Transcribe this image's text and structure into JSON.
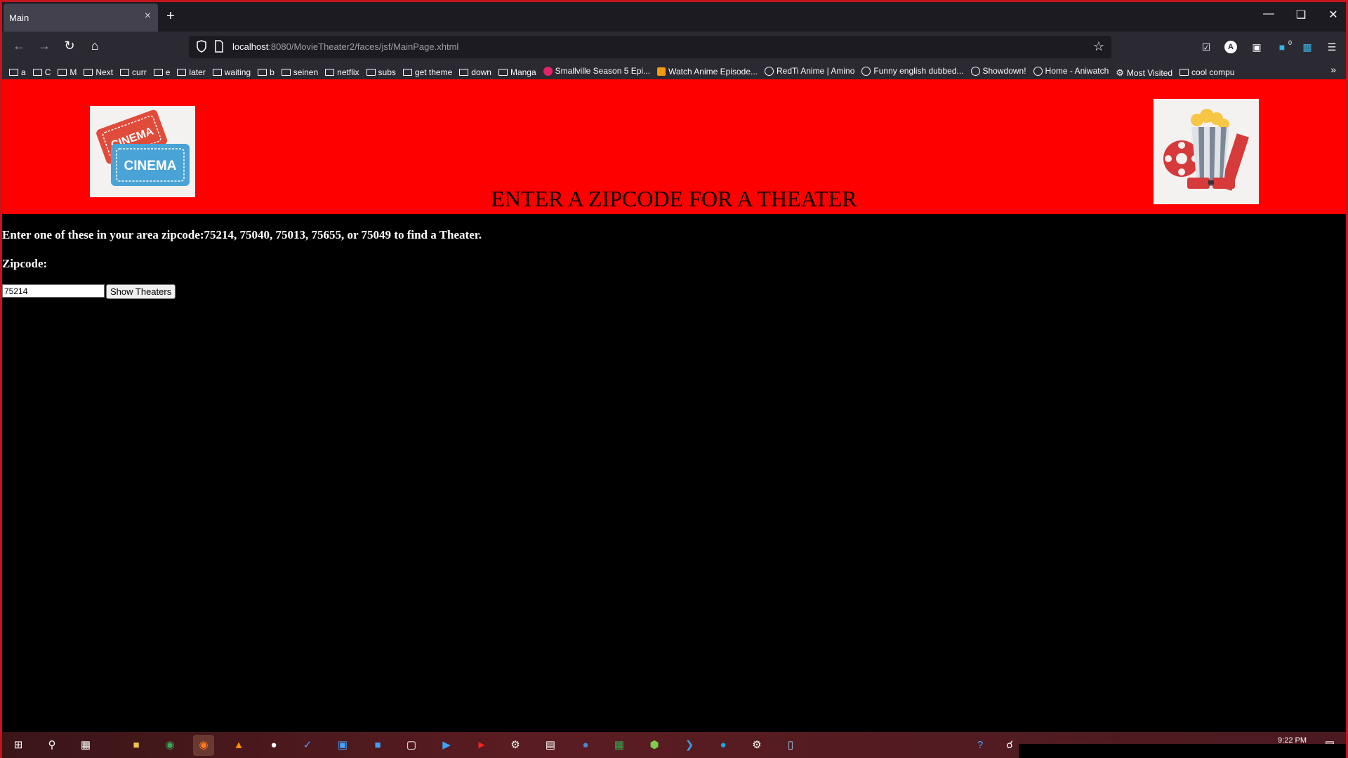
{
  "browser": {
    "tab_title": "Main",
    "tab_close": "×",
    "new_tab": "+",
    "url_host": "localhost",
    "url_rest": ":8080/MovieTheater2/faces/jsf/MainPage.xhtml",
    "profile_letter": "A",
    "badge_count": "0"
  },
  "bookmarks": [
    {
      "label": "a",
      "icon": "folder"
    },
    {
      "label": "C",
      "icon": "folder"
    },
    {
      "label": "M",
      "icon": "folder"
    },
    {
      "label": "Next",
      "icon": "folder"
    },
    {
      "label": "curr",
      "icon": "folder"
    },
    {
      "label": "e",
      "icon": "folder"
    },
    {
      "label": "later",
      "icon": "folder"
    },
    {
      "label": "waiting",
      "icon": "folder"
    },
    {
      "label": "b",
      "icon": "folder"
    },
    {
      "label": "seinen",
      "icon": "folder"
    },
    {
      "label": "netflix",
      "icon": "folder"
    },
    {
      "label": "subs",
      "icon": "folder"
    },
    {
      "label": "get theme",
      "icon": "folder"
    },
    {
      "label": "down",
      "icon": "folder"
    },
    {
      "label": "Manga",
      "icon": "folder"
    },
    {
      "label": "Smallville Season 5 Epi...",
      "icon": "yt"
    },
    {
      "label": "Watch Anime Episode...",
      "icon": "ao"
    },
    {
      "label": "RedTi Anime | Amino",
      "icon": "globe"
    },
    {
      "label": "Funny english dubbed...",
      "icon": "globe"
    },
    {
      "label": "Showdown!",
      "icon": "globe"
    },
    {
      "label": "Home - Aniwatch",
      "icon": "globe"
    },
    {
      "label": "Most Visited",
      "icon": "gear"
    },
    {
      "label": "cool compu",
      "icon": "folder"
    }
  ],
  "page": {
    "title": "ENTER A ZIPCODE FOR A THEATER",
    "instructions": "Enter one of these in your area zipcode:75214, 75040, 75013, 75655, or 75049 to find a Theater.",
    "zip_label": "Zipcode:",
    "zip_value": "75214",
    "button_label": "Show Theaters",
    "logo_text_top": "CINEMA",
    "logo_text_bottom": "CINEMA"
  },
  "taskbar": {
    "clock": "9:22 PM"
  },
  "colors": {
    "header_bg": "#ff0000",
    "page_bg": "#000000",
    "window_border": "#c4151c"
  }
}
